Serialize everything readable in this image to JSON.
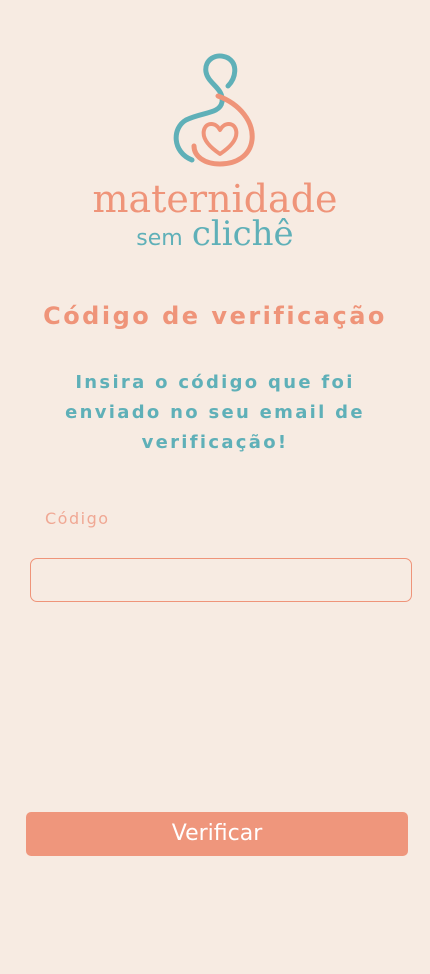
{
  "brand": {
    "line1": "maternidade",
    "line2_a": "sem",
    "line2_b": "clichê",
    "colors": {
      "coral": "#ef9479",
      "teal": "#5fb0b8",
      "background": "#f7ebe2"
    },
    "logo_icon": "mother-heart-logo-icon"
  },
  "page": {
    "title": "Código de verificação",
    "instructions": "Insira o código que foi enviado no seu email de verificação!"
  },
  "form": {
    "code_label": "Código",
    "code_value": "",
    "code_placeholder": "",
    "submit_label": "Verificar"
  }
}
